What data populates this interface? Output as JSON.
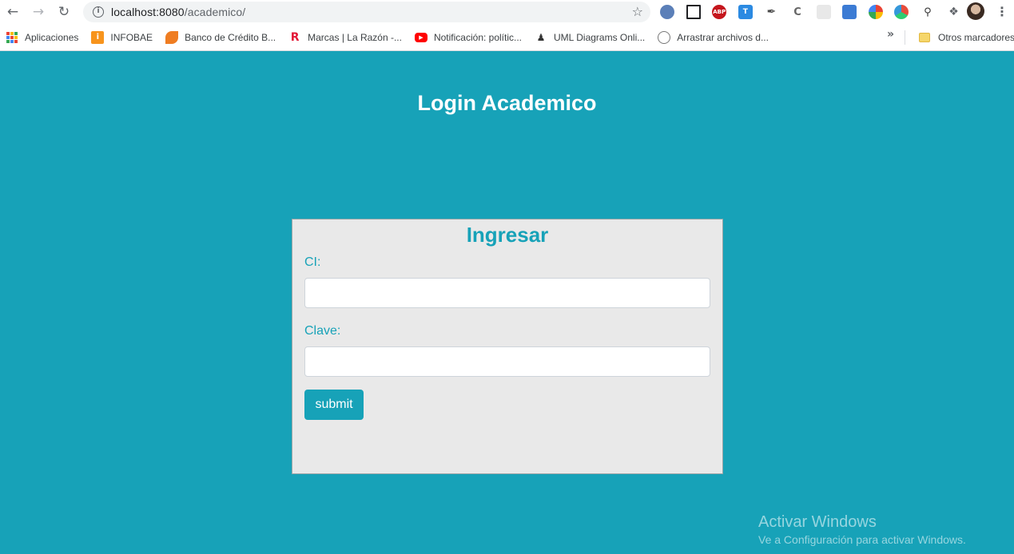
{
  "browser": {
    "url_host": "localhost:8080",
    "url_path": "/academico/",
    "bookmarks": [
      {
        "label": "Aplicaciones",
        "icon": "apps-grid-icon"
      },
      {
        "label": "INFOBAE",
        "icon": "infobae-icon",
        "color": "#f7941d"
      },
      {
        "label": "Banco de Crédito B...",
        "icon": "bcp-icon",
        "color": "#ef7d22"
      },
      {
        "label": "Marcas | La Razón -...",
        "icon": "la-razon-icon",
        "color": "#e31937"
      },
      {
        "label": "Notificación: polític...",
        "icon": "youtube-icon",
        "color": "#ff0000"
      },
      {
        "label": "UML Diagrams Onli...",
        "icon": "uml-diagrams-icon",
        "color": "#333333"
      },
      {
        "label": "Arrastrar archivos d...",
        "icon": "drag-files-icon",
        "color": "#777777"
      }
    ],
    "other_bookmarks": "Otros marcadores"
  },
  "page": {
    "title": "Login Academico",
    "form": {
      "heading": "Ingresar",
      "ci_label": "CI:",
      "ci_value": "",
      "clave_label": "Clave:",
      "clave_value": "",
      "submit_label": "submit"
    }
  },
  "windows_watermark": {
    "line1": "Activar Windows",
    "line2": "Ve a Configuración para activar Windows."
  },
  "colors": {
    "background": "#17a2b8",
    "card": "#e9e9e9",
    "accent": "#17a2b8"
  }
}
